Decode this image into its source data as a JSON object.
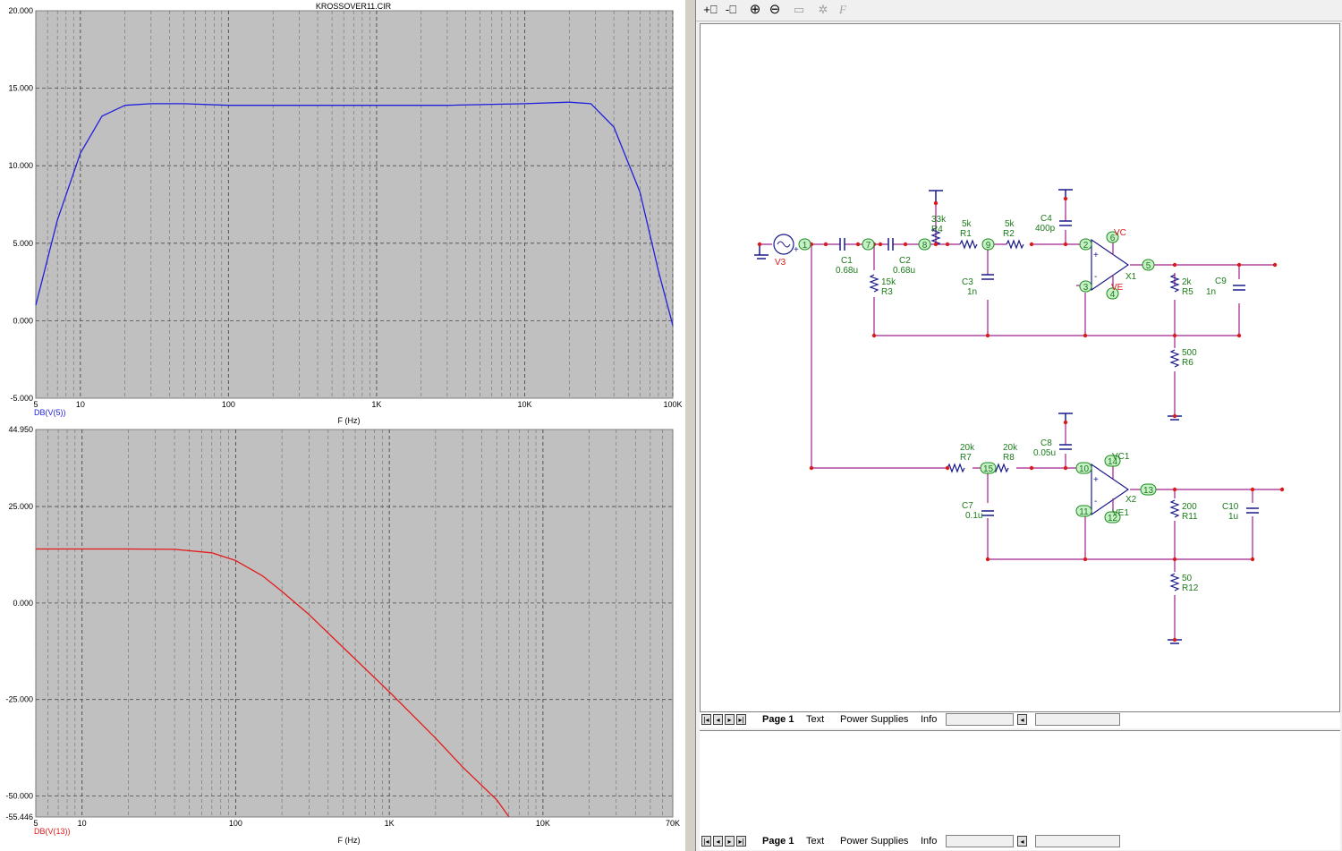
{
  "window": {
    "title": "KROSSOVER11.CIR"
  },
  "plot_top": {
    "y_ticks": [
      "20.000",
      "15.000",
      "10.000",
      "5.000",
      "0.000",
      "-5.000"
    ],
    "x_ticks": [
      "5",
      "10",
      "100",
      "1K",
      "10K",
      "100K"
    ],
    "trace_label": "DB(V(5))",
    "xlabel": "F (Hz)"
  },
  "plot_bottom": {
    "y_ticks": [
      "44.950",
      "25.000",
      "0.000",
      "-25.000",
      "-50.000",
      "-55.446"
    ],
    "x_ticks": [
      "5",
      "10",
      "100",
      "1K",
      "10K",
      "70K"
    ],
    "trace_label": "DB(V(13))",
    "xlabel": "F (Hz)"
  },
  "chart_data": [
    {
      "type": "line",
      "title": "KROSSOVER11.CIR",
      "xlabel": "F (Hz)",
      "ylabel": "",
      "xscale": "log",
      "xlim": [
        5,
        100000
      ],
      "ylim": [
        -5,
        20
      ],
      "grid": true,
      "series": [
        {
          "name": "DB(V(5))",
          "color": "#1f1fdc",
          "x": [
            5,
            7,
            10,
            14,
            20,
            30,
            50,
            100,
            300,
            1000,
            3000,
            10000,
            20000,
            28000,
            40000,
            60000,
            80000,
            100000
          ],
          "y": [
            1.0,
            6.5,
            10.8,
            13.2,
            13.9,
            14.0,
            14.0,
            13.9,
            13.9,
            13.9,
            13.9,
            14.0,
            14.1,
            14.0,
            12.5,
            8.3,
            3.2,
            -0.3
          ]
        }
      ]
    },
    {
      "type": "line",
      "title": "",
      "xlabel": "F (Hz)",
      "ylabel": "",
      "xscale": "log",
      "xlim": [
        5,
        70000
      ],
      "ylim": [
        -55.446,
        44.95
      ],
      "grid": true,
      "series": [
        {
          "name": "DB(V(13))",
          "color": "#e41a1a",
          "x": [
            5,
            10,
            20,
            40,
            70,
            100,
            150,
            200,
            300,
            500,
            1000,
            2000,
            3000,
            5000,
            6000
          ],
          "y": [
            14.0,
            14.0,
            14.0,
            13.9,
            13.0,
            11.0,
            7.0,
            3.0,
            -3.0,
            -11.5,
            -23.0,
            -35.0,
            -42.5,
            -51.0,
            -55.4
          ]
        }
      ]
    }
  ],
  "toolbar": {
    "buttons": [
      {
        "name": "add-page-button",
        "glyph": "+⎕",
        "enabled": true
      },
      {
        "name": "delete-page-button",
        "glyph": "-⎕",
        "enabled": true
      },
      {
        "name": "zoom-in-button",
        "glyph": "⊕",
        "enabled": true
      },
      {
        "name": "zoom-out-button",
        "glyph": "⊖",
        "enabled": true
      },
      {
        "name": "folder-button",
        "glyph": "▭",
        "enabled": false
      },
      {
        "name": "settings-button",
        "glyph": "✲",
        "enabled": false
      },
      {
        "name": "font-button",
        "glyph": "F",
        "enabled": false
      }
    ]
  },
  "tabs": [
    "Page 1",
    "Text",
    "Power Supplies",
    "Info"
  ],
  "schematic": {
    "labels": {
      "V3": "V3",
      "C1": "C1",
      "C1v": "0.68u",
      "C2": "C2",
      "C2v": "0.68u",
      "R3v": "15k",
      "R3": "R3",
      "R4v": "33k",
      "R4": "R4",
      "R1v": "5k",
      "R1": "R1",
      "R2v": "5k",
      "R2": "R2",
      "C3": "C3",
      "C3v": "1n",
      "C4": "C4",
      "C4v": "400p",
      "VC": "VC",
      "VE": "VE",
      "X1": "X1",
      "R5v": "2k",
      "R5": "R5",
      "C9": "C9",
      "C9v": "1n",
      "R6v": "500",
      "R6": "R6",
      "R7v": "20k",
      "R7": "R7",
      "R8v": "20k",
      "R8": "R8",
      "C8": "C8",
      "C8v": "0.05u",
      "C7": "C7",
      "C7v": "0.1u",
      "VC1": "VC1",
      "VE1": "VE1",
      "X2": "X2",
      "R11v": "200",
      "R11": "R11",
      "C10": "C10",
      "C10v": "1u",
      "R12v": "50",
      "R12": "R12",
      "n1": "1",
      "n2": "2",
      "n3": "3",
      "n4": "4",
      "n5": "5",
      "n6": "6",
      "n7": "7",
      "n8": "8",
      "n9": "9",
      "n10": "10",
      "n11": "11",
      "n12": "12",
      "n13": "13",
      "n14": "14",
      "n15": "15",
      "plus": "+",
      "minus": "-"
    }
  }
}
